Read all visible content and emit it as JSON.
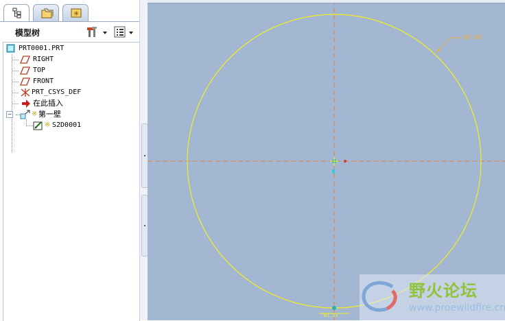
{
  "tabs": [
    {
      "icon": "model-tree-icon",
      "active": true
    },
    {
      "icon": "folder-browser-icon",
      "active": false
    },
    {
      "icon": "favorites-icon",
      "active": false
    }
  ],
  "tree_header": {
    "title": "模型树",
    "settings_icon": "tools-icon",
    "show_icon": "show-list-icon"
  },
  "tree": {
    "items": [
      {
        "label": "PRT0001.PRT",
        "icon": "part-icon"
      },
      {
        "label": "RIGHT",
        "icon": "datum-plane-icon"
      },
      {
        "label": "TOP",
        "icon": "datum-plane-icon"
      },
      {
        "label": "FRONT",
        "icon": "datum-plane-icon"
      },
      {
        "label": "PRT_CSYS_DEF",
        "icon": "csys-icon"
      },
      {
        "label": "在此插入",
        "icon": "insert-here-arrow-icon"
      },
      {
        "label": "第一壁",
        "icon": "first-wall-feature-icon",
        "prefix": "※"
      },
      {
        "label": "S2D0001",
        "icon": "sketch-icon",
        "prefix": "※"
      }
    ]
  },
  "sketch": {
    "dimension_label": "80.00",
    "bottom_label": "B1.1x",
    "line_color": "#f2f01e",
    "axis_color": "#e0823c",
    "background": "#a3b7d2"
  },
  "watermark": {
    "title": "野火论坛",
    "url": "www.proewildfire.cn"
  }
}
